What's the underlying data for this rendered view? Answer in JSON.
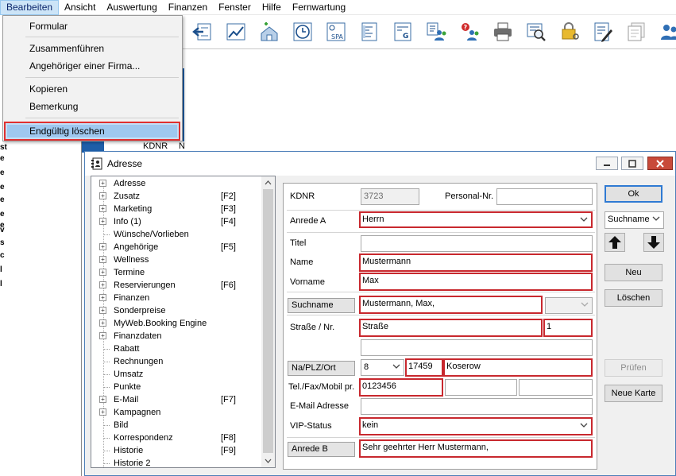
{
  "menubar": {
    "items": [
      "Bearbeiten",
      "Ansicht",
      "Auswertung",
      "Finanzen",
      "Fenster",
      "Hilfe",
      "Fernwartung"
    ]
  },
  "dropdown": {
    "items": [
      "Formular",
      "Zusammenführen",
      "Angehöriger einer Firma...",
      "Kopieren",
      "Bemerkung",
      "Endgültig löschen"
    ]
  },
  "background": {
    "kdnr": "KDNR",
    "kdnr_suffix": "N",
    "strip_chars": [
      "st",
      "e",
      "e",
      "e",
      "e",
      "e",
      "e",
      "v",
      "s",
      "c",
      "l",
      "l"
    ]
  },
  "toolbar": {
    "icons": [
      "import-icon",
      "chart-icon",
      "house-plus-icon",
      "clock-icon",
      "spa-icon",
      "form-icon",
      "form-g-icon",
      "people-list-icon",
      "people-question-icon",
      "printer-icon",
      "search-doc-icon",
      "lock-key-icon",
      "edit-doc-icon",
      "doc-stack-icon",
      "users-icon"
    ]
  },
  "window": {
    "title": "Adresse"
  },
  "tree": {
    "nodes": [
      {
        "label": "Adresse",
        "key": "",
        "expandable": true
      },
      {
        "label": "Zusatz",
        "key": "[F2]",
        "expandable": true
      },
      {
        "label": "Marketing",
        "key": "[F3]",
        "expandable": true
      },
      {
        "label": "Info (1)",
        "key": "[F4]",
        "expandable": true
      },
      {
        "label": "Wünsche/Vorlieben",
        "key": "",
        "expandable": false
      },
      {
        "label": "Angehörige",
        "key": "[F5]",
        "expandable": true
      },
      {
        "label": "Wellness",
        "key": "",
        "expandable": true
      },
      {
        "label": "Termine",
        "key": "",
        "expandable": true
      },
      {
        "label": "Reservierungen",
        "key": "[F6]",
        "expandable": true
      },
      {
        "label": "Finanzen",
        "key": "",
        "expandable": true
      },
      {
        "label": "Sonderpreise",
        "key": "",
        "expandable": true
      },
      {
        "label": "MyWeb.Booking Engine",
        "key": "",
        "expandable": true
      },
      {
        "label": "Finanzdaten",
        "key": "",
        "expandable": true
      },
      {
        "label": "Rabatt",
        "key": "",
        "expandable": false
      },
      {
        "label": "Rechnungen",
        "key": "",
        "expandable": false
      },
      {
        "label": "Umsatz",
        "key": "",
        "expandable": false
      },
      {
        "label": "Punkte",
        "key": "",
        "expandable": false
      },
      {
        "label": "E-Mail",
        "key": "[F7]",
        "expandable": true
      },
      {
        "label": "Kampagnen",
        "key": "",
        "expandable": true
      },
      {
        "label": "Bild",
        "key": "",
        "expandable": false
      },
      {
        "label": "Korrespondenz",
        "key": "[F8]",
        "expandable": false
      },
      {
        "label": "Historie",
        "key": "[F9]",
        "expandable": false
      },
      {
        "label": "Historie 2",
        "key": "",
        "expandable": false
      }
    ]
  },
  "form": {
    "kdnr_label": "KDNR",
    "kdnr_value": "3723",
    "personal_nr_label": "Personal-Nr.",
    "personal_nr_value": "",
    "anrede_a_label": "Anrede A",
    "anrede_a_value": "Herrn",
    "titel_label": "Titel",
    "titel_value": "",
    "name_label": "Name",
    "name_value": "Mustermann",
    "vorname_label": "Vorname",
    "vorname_value": "Max",
    "suchname_label": "Suchname",
    "suchname_value": "Mustermann, Max,",
    "strasse_label": "Straße / Nr.",
    "strasse_value": "Straße",
    "hausnr_value": "1",
    "strasse2_value": "",
    "plz_label": "Na/PLZ/Ort",
    "nation_value": "8",
    "plz_value": "17459",
    "ort_value": "Koserow",
    "tel_label": "Tel./Fax/Mobil pr.",
    "tel_value": "0123456",
    "fax_value": "",
    "mobil_value": "",
    "email_label": "E-Mail Adresse",
    "email_value": "",
    "vip_label": "VIP-Status",
    "vip_value": "kein",
    "anrede_b_label": "Anrede B",
    "anrede_b_value": "Sehr geehrter Herr Mustermann,"
  },
  "buttons": {
    "ok": "Ok",
    "sort_select": "Suchname",
    "neu": "Neu",
    "loeschen": "Löschen",
    "pruefen": "Prüfen",
    "neue_karte": "Neue Karte"
  },
  "colors": {
    "highlight_border": "#c8282e",
    "accent_blue": "#1e5ea8"
  }
}
